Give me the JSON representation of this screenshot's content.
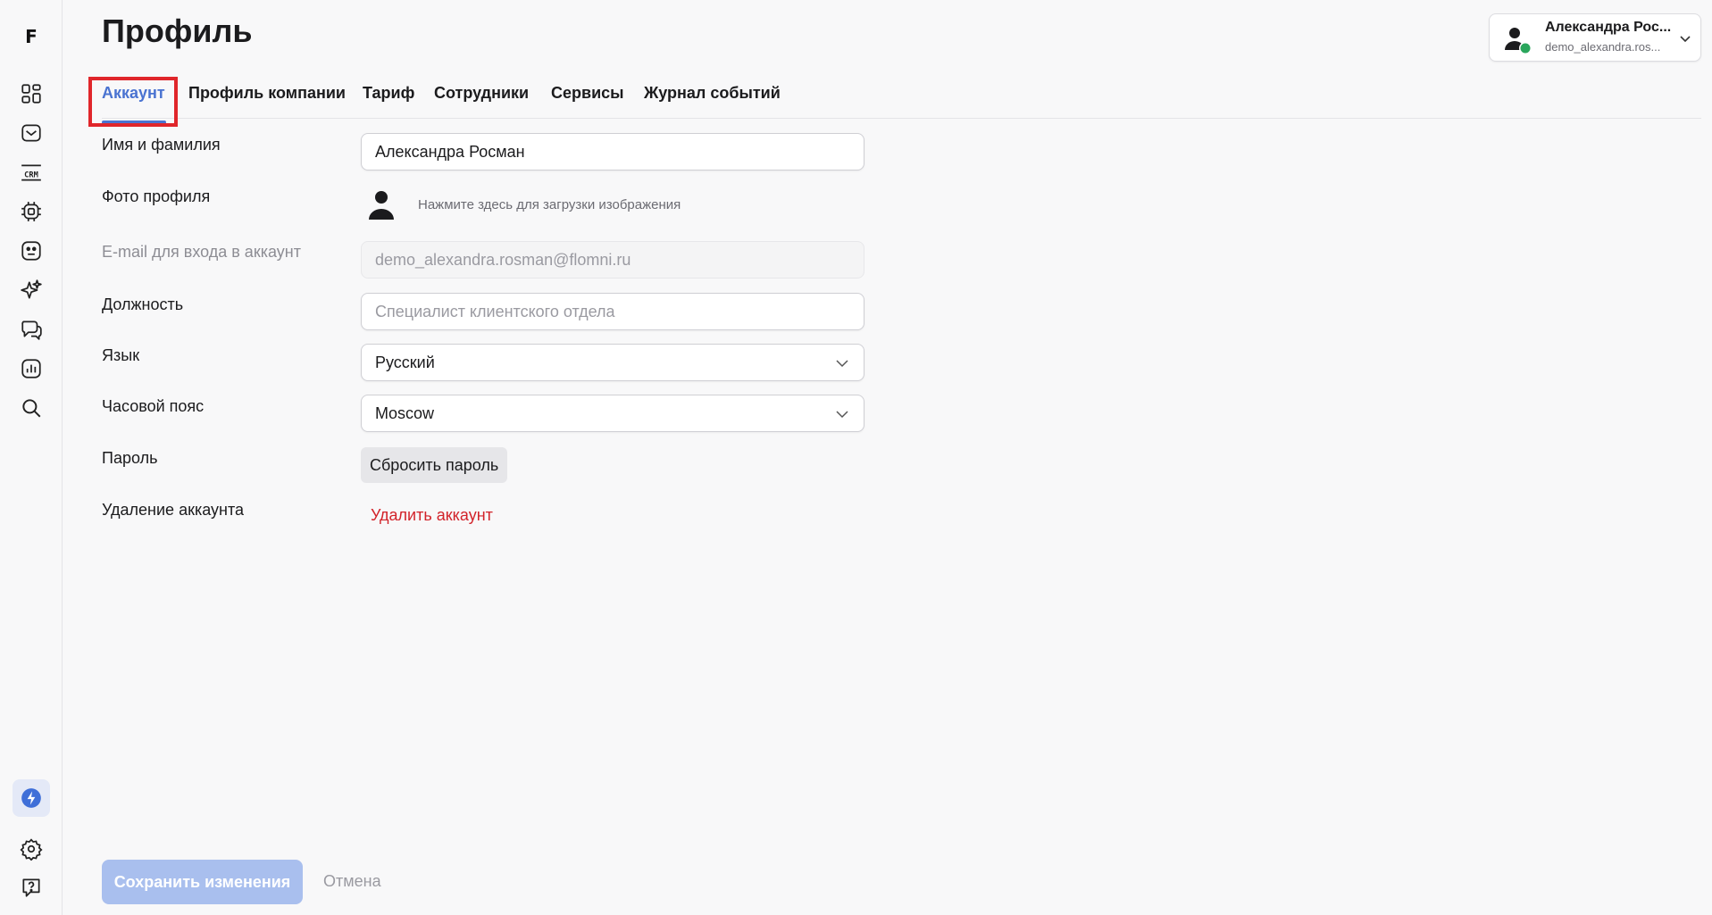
{
  "sidebar": {
    "logo": "F",
    "items": [
      {
        "icon": "dashboard-icon"
      },
      {
        "icon": "inbox-icon"
      },
      {
        "icon": "crm-icon",
        "label": "CRM"
      },
      {
        "icon": "chip-icon"
      },
      {
        "icon": "bot-face-icon"
      },
      {
        "icon": "sparkles-icon"
      },
      {
        "icon": "chat-bubbles-icon"
      },
      {
        "icon": "analytics-icon"
      },
      {
        "icon": "search-icon"
      }
    ],
    "bottom": [
      {
        "icon": "bolt-icon"
      },
      {
        "icon": "gear-icon"
      },
      {
        "icon": "help-icon"
      }
    ]
  },
  "page": {
    "title": "Профиль"
  },
  "user": {
    "name": "Александра Рос...",
    "email": "demo_alexandra.ros...",
    "status_color": "#2aa65c"
  },
  "tabs": [
    {
      "label": "Аккаунт",
      "active": true
    },
    {
      "label": "Профиль компании"
    },
    {
      "label": "Тариф"
    },
    {
      "label": "Сотрудники"
    },
    {
      "label": "Сервисы"
    },
    {
      "label": "Журнал событий"
    }
  ],
  "form": {
    "name": {
      "label": "Имя и фамилия",
      "value": "Александра Росман"
    },
    "photo": {
      "label": "Фото профиля",
      "link": "Нажмите здесь для загрузки изображения"
    },
    "email": {
      "label": "E-mail для входа в аккаунт",
      "value": "demo_alexandra.rosman@flomni.ru"
    },
    "position": {
      "label": "Должность",
      "placeholder": "Специалист клиентского отдела"
    },
    "language": {
      "label": "Язык",
      "value": "Русский"
    },
    "timezone": {
      "label": "Часовой пояс",
      "value": "Moscow"
    },
    "password": {
      "label": "Пароль",
      "button": "Сбросить пароль"
    },
    "delete": {
      "label": "Удаление аккаунта",
      "link": "Удалить аккаунт"
    }
  },
  "footer": {
    "save": "Сохранить изменения",
    "cancel": "Отмена"
  },
  "colors": {
    "accent": "#4a73d1",
    "danger": "#d2232a",
    "highlight": "#e0262b",
    "save_disabled": "#a9bfee"
  }
}
